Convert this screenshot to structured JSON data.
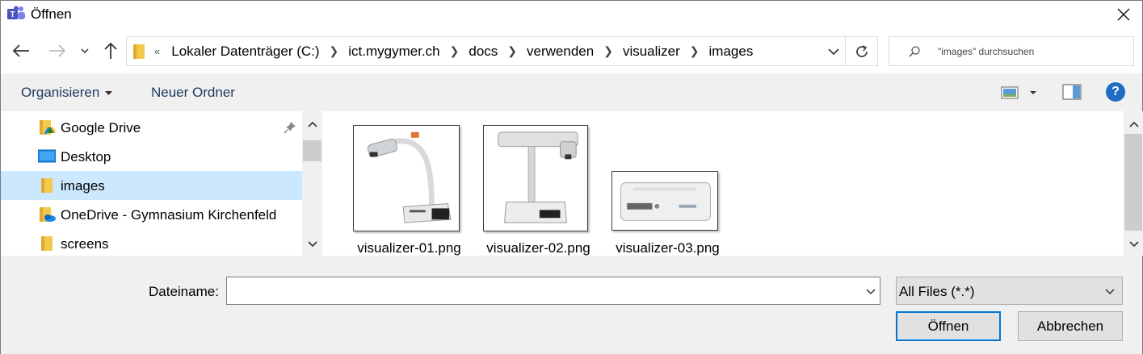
{
  "window": {
    "title": "Öffnen"
  },
  "address": {
    "overflow_glyph": "«",
    "crumbs": [
      "Lokaler Datenträger (C:)",
      "ict.mygymer.ch",
      "docs",
      "verwenden",
      "visualizer",
      "images"
    ]
  },
  "search": {
    "placeholder": "\"images\" durchsuchen"
  },
  "toolbar": {
    "organize_label": "Organisieren",
    "new_folder_label": "Neuer Ordner",
    "help_glyph": "?"
  },
  "nav": {
    "items": [
      {
        "label": "Google Drive",
        "icon": "google-drive-folder-icon",
        "pinned": true
      },
      {
        "label": "Desktop",
        "icon": "desktop-icon"
      },
      {
        "label": "images",
        "icon": "folder-icon",
        "selected": true
      },
      {
        "label": "OneDrive - Gymnasium Kirchenfeld",
        "icon": "onedrive-folder-icon"
      },
      {
        "label": "screens",
        "icon": "folder-icon"
      }
    ]
  },
  "files": [
    {
      "name": "visualizer-01.png"
    },
    {
      "name": "visualizer-02.png"
    },
    {
      "name": "visualizer-03.png"
    }
  ],
  "bottom": {
    "filename_label": "Dateiname:",
    "filename_value": "",
    "filter_value": "All Files (*.*)",
    "open_label": "Öffnen",
    "cancel_label": "Abbrechen"
  },
  "colors": {
    "accent": "#0078d7",
    "selection": "#cce8ff",
    "chrome": "#f0f0f0",
    "help": "#1f6cc4"
  }
}
